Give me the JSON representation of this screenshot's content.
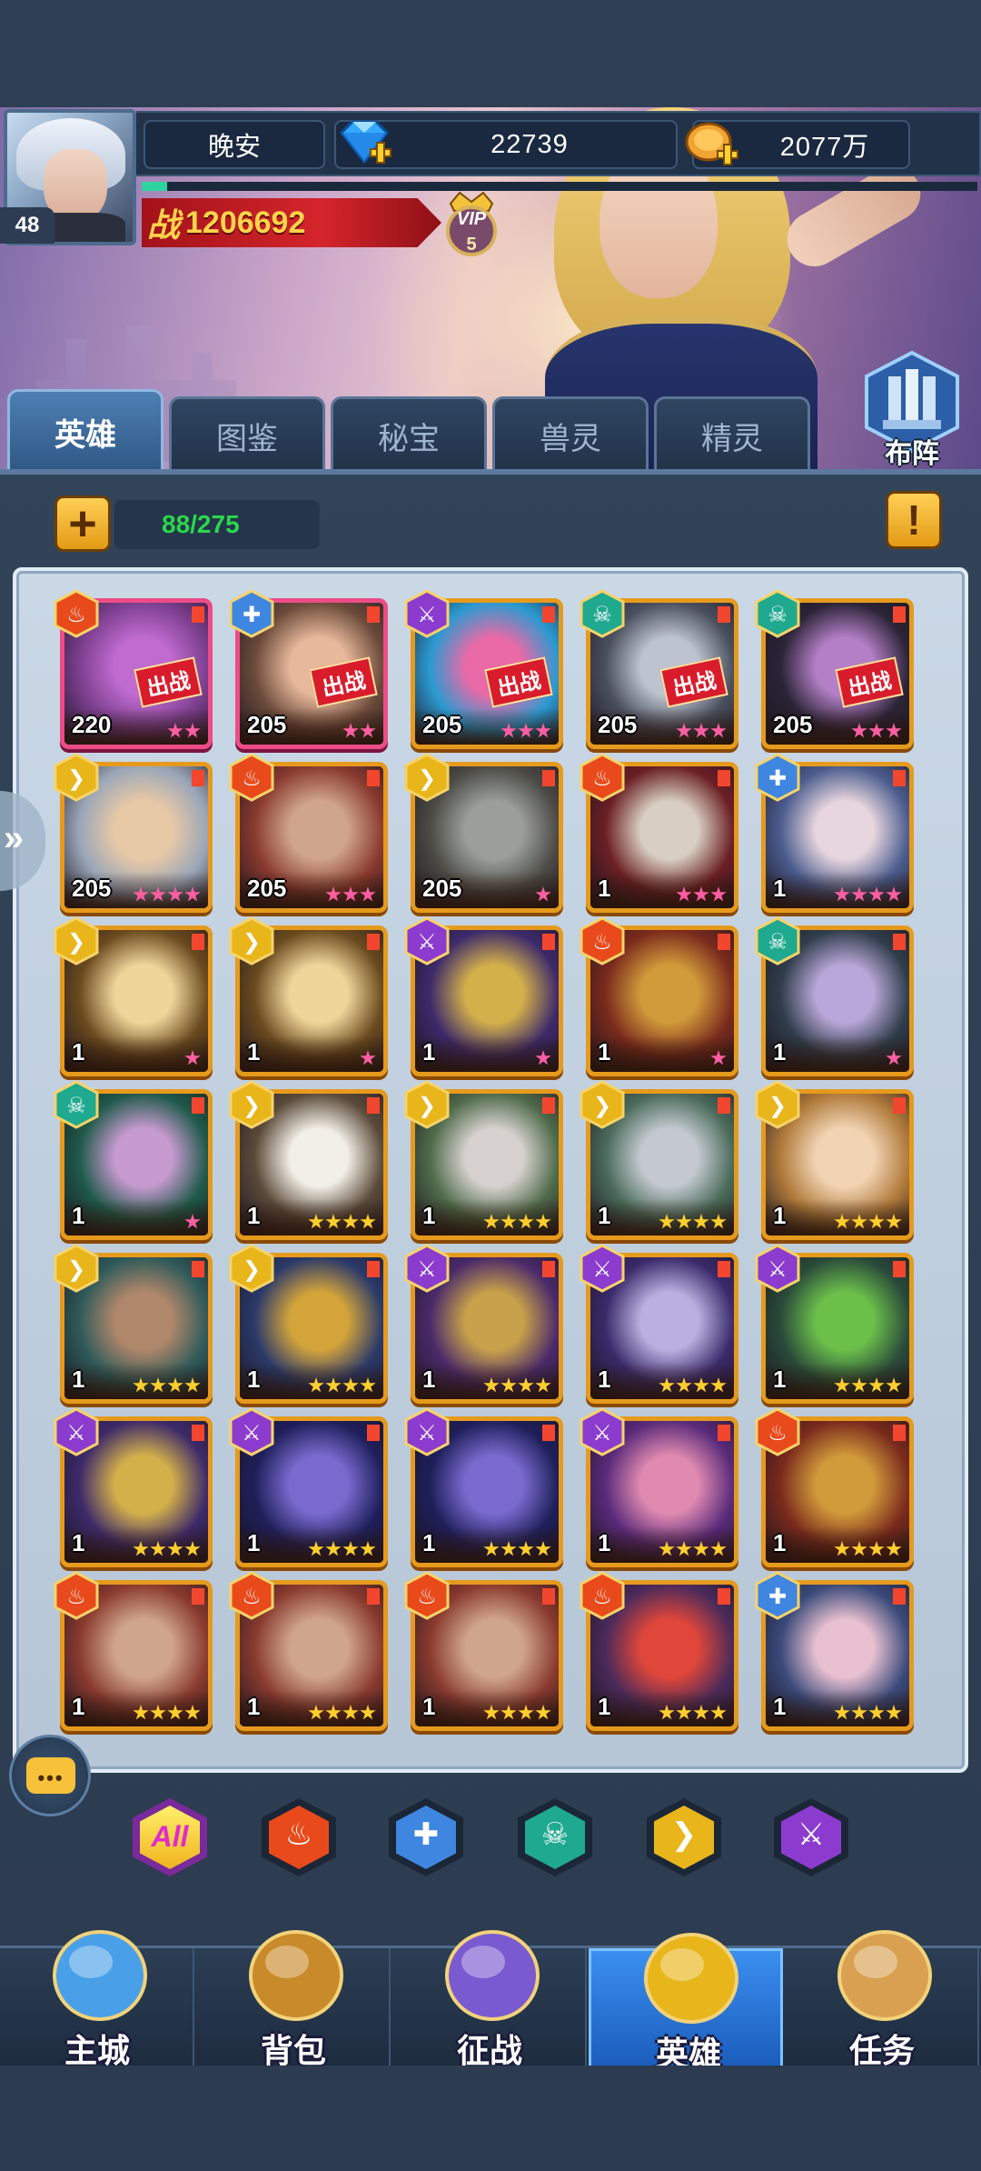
{
  "player": {
    "name": "晚安",
    "level": "48",
    "gems": "22739",
    "gold": "2077万",
    "power_label": "战",
    "power": "1206692",
    "vip_label": "VIP",
    "vip_level": "5",
    "exp_progress": 0.03
  },
  "formation_label": "布阵",
  "tabs": [
    "英雄",
    "图鉴",
    "秘宝",
    "兽灵",
    "精灵"
  ],
  "active_tab": 0,
  "capacity": "88/275",
  "deployed_label": "出战",
  "factions": {
    "fire": {
      "color": "#e84a1c",
      "icon": "flame-icon"
    },
    "water": {
      "color": "#3f86e0",
      "icon": "cross-icon"
    },
    "dark": {
      "color": "#8b3ccf",
      "icon": "claw-icon"
    },
    "undead": {
      "color": "#1fa98f",
      "icon": "skull-icon"
    },
    "light": {
      "color": "#e8b51a",
      "icon": "wing-icon"
    }
  },
  "heroes": [
    {
      "level": "220",
      "faction": "fire",
      "stars": 2,
      "star_color": "pink",
      "deployed": true,
      "frame": "pink",
      "palette": [
        "#7d3f8f",
        "#c06bd0"
      ]
    },
    {
      "level": "205",
      "faction": "water",
      "stars": 2,
      "star_color": "pink",
      "deployed": true,
      "frame": "pink",
      "palette": [
        "#6b4a3a",
        "#e7b89a"
      ]
    },
    {
      "level": "205",
      "faction": "dark",
      "stars": 3,
      "star_color": "pink",
      "deployed": true,
      "frame": "gold",
      "palette": [
        "#2b9ad1",
        "#e96aa7"
      ]
    },
    {
      "level": "205",
      "faction": "undead",
      "stars": 3,
      "star_color": "pink",
      "deployed": true,
      "frame": "gold",
      "palette": [
        "#4a4f5e",
        "#bdc3cf"
      ]
    },
    {
      "level": "205",
      "faction": "undead",
      "stars": 3,
      "star_color": "pink",
      "deployed": true,
      "frame": "gold",
      "palette": [
        "#2a2436",
        "#b47fc7"
      ]
    },
    {
      "level": "205",
      "faction": "light",
      "stars": 4,
      "star_color": "pink",
      "deployed": false,
      "frame": "gold",
      "palette": [
        "#9aa6b8",
        "#e8c9a6"
      ]
    },
    {
      "level": "205",
      "faction": "fire",
      "stars": 3,
      "star_color": "pink",
      "deployed": false,
      "frame": "gold",
      "palette": [
        "#8a3a2e",
        "#d0a58d"
      ]
    },
    {
      "level": "205",
      "faction": "light",
      "stars": 1,
      "star_color": "pink",
      "deployed": false,
      "frame": "gold",
      "palette": [
        "#4b4a45",
        "#9a9f9c"
      ]
    },
    {
      "level": "1",
      "faction": "fire",
      "stars": 3,
      "star_color": "pink",
      "deployed": false,
      "frame": "gold",
      "palette": [
        "#6b1f24",
        "#d8cfc2"
      ]
    },
    {
      "level": "1",
      "faction": "water",
      "stars": 4,
      "star_color": "pink",
      "deployed": false,
      "frame": "gold",
      "palette": [
        "#4b5c8e",
        "#e8d6de"
      ]
    },
    {
      "level": "1",
      "faction": "light",
      "stars": 1,
      "star_color": "pink",
      "deployed": false,
      "frame": "gold",
      "palette": [
        "#6a4a1e",
        "#f0d59a"
      ]
    },
    {
      "level": "1",
      "faction": "light",
      "stars": 1,
      "star_color": "pink",
      "deployed": false,
      "frame": "gold",
      "palette": [
        "#6a4a1e",
        "#f0d59a"
      ]
    },
    {
      "level": "1",
      "faction": "dark",
      "stars": 1,
      "star_color": "pink",
      "deployed": false,
      "frame": "gold",
      "palette": [
        "#3d2a6a",
        "#d4b04a"
      ]
    },
    {
      "level": "1",
      "faction": "fire",
      "stars": 1,
      "star_color": "pink",
      "deployed": false,
      "frame": "gold",
      "palette": [
        "#7a2a1c",
        "#d19a3a"
      ]
    },
    {
      "level": "1",
      "faction": "undead",
      "stars": 1,
      "star_color": "pink",
      "deployed": false,
      "frame": "gold",
      "palette": [
        "#2f3d4a",
        "#b9a7d9"
      ]
    },
    {
      "level": "1",
      "faction": "undead",
      "stars": 1,
      "star_color": "pink",
      "deployed": false,
      "frame": "gold",
      "palette": [
        "#1f5a4a",
        "#c79ad0"
      ]
    },
    {
      "level": "1",
      "faction": "light",
      "stars": 4,
      "star_color": "gold",
      "deployed": false,
      "frame": "gold",
      "palette": [
        "#5a4a3a",
        "#f2efe6"
      ]
    },
    {
      "level": "1",
      "faction": "light",
      "stars": 4,
      "star_color": "gold",
      "deployed": false,
      "frame": "gold",
      "palette": [
        "#4f6a4a",
        "#d6d1cf"
      ]
    },
    {
      "level": "1",
      "faction": "light",
      "stars": 4,
      "star_color": "gold",
      "deployed": false,
      "frame": "gold",
      "palette": [
        "#4a6a5a",
        "#c4c9cf"
      ]
    },
    {
      "level": "1",
      "faction": "light",
      "stars": 4,
      "star_color": "gold",
      "deployed": false,
      "frame": "gold",
      "palette": [
        "#b07a3a",
        "#f2d4b4"
      ]
    },
    {
      "level": "1",
      "faction": "light",
      "stars": 4,
      "star_color": "gold",
      "deployed": false,
      "frame": "gold",
      "palette": [
        "#2f5a5a",
        "#b0876a"
      ]
    },
    {
      "level": "1",
      "faction": "light",
      "stars": 4,
      "star_color": "gold",
      "deployed": false,
      "frame": "gold",
      "palette": [
        "#2b3a6a",
        "#d4a43a"
      ]
    },
    {
      "level": "1",
      "faction": "dark",
      "stars": 4,
      "star_color": "gold",
      "deployed": false,
      "frame": "gold",
      "palette": [
        "#4a2a6a",
        "#c9a14a"
      ]
    },
    {
      "level": "1",
      "faction": "dark",
      "stars": 4,
      "star_color": "gold",
      "deployed": false,
      "frame": "gold",
      "palette": [
        "#3a2a6a",
        "#b9b0e0"
      ]
    },
    {
      "level": "1",
      "faction": "dark",
      "stars": 4,
      "star_color": "gold",
      "deployed": false,
      "frame": "gold",
      "palette": [
        "#2a4a3a",
        "#6bc04a"
      ]
    },
    {
      "level": "1",
      "faction": "dark",
      "stars": 4,
      "star_color": "gold",
      "deployed": false,
      "frame": "gold",
      "palette": [
        "#3d2a6a",
        "#d4b04a"
      ]
    },
    {
      "level": "1",
      "faction": "dark",
      "stars": 4,
      "star_color": "gold",
      "deployed": false,
      "frame": "gold",
      "palette": [
        "#1e1f5a",
        "#7a6ad0"
      ]
    },
    {
      "level": "1",
      "faction": "dark",
      "stars": 4,
      "star_color": "gold",
      "deployed": false,
      "frame": "gold",
      "palette": [
        "#1e1f5a",
        "#7a6ad0"
      ]
    },
    {
      "level": "1",
      "faction": "dark",
      "stars": 4,
      "star_color": "gold",
      "deployed": false,
      "frame": "gold",
      "palette": [
        "#5a2a7a",
        "#e08ab0"
      ]
    },
    {
      "level": "1",
      "faction": "fire",
      "stars": 4,
      "star_color": "gold",
      "deployed": false,
      "frame": "gold",
      "palette": [
        "#7a2a1c",
        "#d19a3a"
      ]
    },
    {
      "level": "1",
      "faction": "fire",
      "stars": 4,
      "star_color": "gold",
      "deployed": false,
      "frame": "gold",
      "palette": [
        "#8a3a2e",
        "#d0a58d"
      ]
    },
    {
      "level": "1",
      "faction": "fire",
      "stars": 4,
      "star_color": "gold",
      "deployed": false,
      "frame": "gold",
      "palette": [
        "#8a3a2e",
        "#d0a58d"
      ]
    },
    {
      "level": "1",
      "faction": "fire",
      "stars": 4,
      "star_color": "gold",
      "deployed": false,
      "frame": "gold",
      "palette": [
        "#8a3a2e",
        "#d0a58d"
      ]
    },
    {
      "level": "1",
      "faction": "fire",
      "stars": 4,
      "star_color": "gold",
      "deployed": false,
      "frame": "gold",
      "palette": [
        "#4a2a5a",
        "#e0463a"
      ]
    },
    {
      "level": "1",
      "faction": "water",
      "stars": 4,
      "star_color": "gold",
      "deployed": false,
      "frame": "gold",
      "palette": [
        "#3a4a7a",
        "#e8c0d0"
      ]
    }
  ],
  "filters": {
    "all_label": "All",
    "items": [
      {
        "faction": "fire",
        "icon": "flame-icon"
      },
      {
        "faction": "water",
        "icon": "cross-icon"
      },
      {
        "faction": "undead",
        "icon": "skull-icon"
      },
      {
        "faction": "light",
        "icon": "wing-icon"
      },
      {
        "faction": "dark",
        "icon": "claw-icon"
      }
    ]
  },
  "chat_dots": "•••",
  "nav": [
    {
      "label": "主城",
      "icon": "castle-icon",
      "color": "#4aa0e8"
    },
    {
      "label": "背包",
      "icon": "treasure-chest-icon",
      "color": "#c98a2a"
    },
    {
      "label": "征战",
      "icon": "dragon-portal-icon",
      "color": "#7a5ad0"
    },
    {
      "label": "英雄",
      "icon": "golden-helmet-icon",
      "color": "#e8b51a"
    },
    {
      "label": "任务",
      "icon": "scroll-icon",
      "color": "#d8a050"
    }
  ],
  "active_nav": 3
}
